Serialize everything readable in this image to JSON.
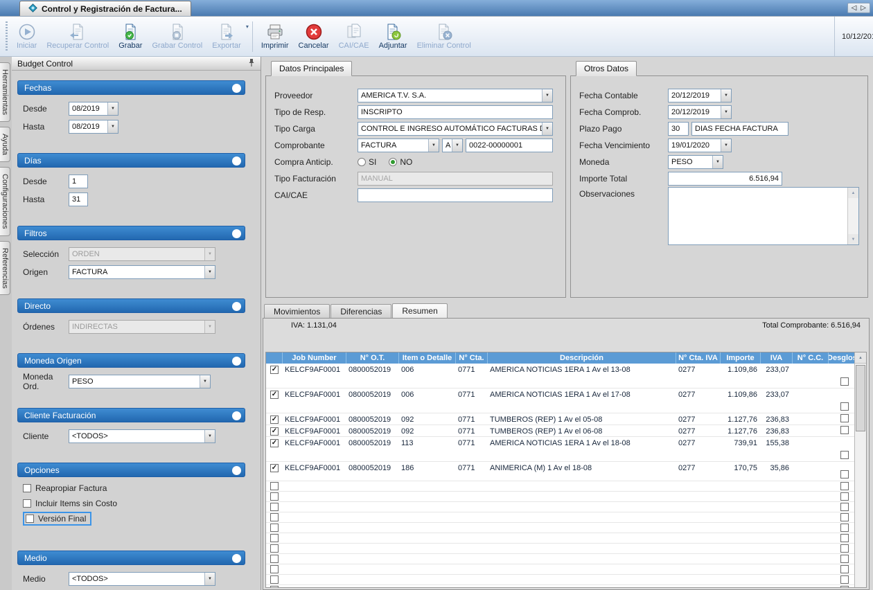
{
  "window": {
    "tab_title": "Control y Registración de Factura...",
    "nav_left_glyph": "◁",
    "nav_right_glyph": "▷"
  },
  "toolbar": {
    "date": "10/12/201",
    "buttons": [
      {
        "label": "Iniciar",
        "enabled": false
      },
      {
        "label": "Recuperar Control",
        "enabled": false
      },
      {
        "label": "Grabar",
        "enabled": true
      },
      {
        "label": "Grabar Control",
        "enabled": false
      },
      {
        "label": "Exportar",
        "enabled": false
      },
      {
        "label": "Imprimir",
        "enabled": true
      },
      {
        "label": "Cancelar",
        "enabled": true
      },
      {
        "label": "CAI/CAE",
        "enabled": false
      },
      {
        "label": "Adjuntar",
        "enabled": true
      },
      {
        "label": "Eliminar Control",
        "enabled": false
      }
    ]
  },
  "side_tabs": [
    {
      "label": "Herramientas"
    },
    {
      "label": "Ayuda"
    },
    {
      "label": "Configuraciones"
    },
    {
      "label": "Referencias"
    }
  ],
  "sidebar": {
    "title": "Budget Control",
    "fechas": {
      "title": "Fechas",
      "desde_label": "Desde",
      "desde_value": "08/2019",
      "hasta_label": "Hasta",
      "hasta_value": "08/2019"
    },
    "dias": {
      "title": "Días",
      "desde_label": "Desde",
      "desde_value": "1",
      "hasta_label": "Hasta",
      "hasta_value": "31"
    },
    "filtros": {
      "title": "Filtros",
      "seleccion_label": "Selección",
      "seleccion_value": "ORDEN",
      "origen_label": "Origen",
      "origen_value": "FACTURA"
    },
    "directo": {
      "title": "Directo",
      "ordenes_label": "Órdenes",
      "ordenes_value": "INDIRECTAS"
    },
    "moneda_origen": {
      "title": "Moneda Origen",
      "label": "Moneda Ord.",
      "value": "PESO"
    },
    "cliente_facturacion": {
      "title": "Cliente Facturación",
      "label": "Cliente",
      "value": "<TODOS>"
    },
    "opciones": {
      "title": "Opciones",
      "items": [
        {
          "label": "Reapropiar Factura",
          "checked": false
        },
        {
          "label": "Incluir Items sin Costo",
          "checked": false
        },
        {
          "label": "Versión Final",
          "checked": false,
          "focused": true
        }
      ]
    },
    "medio": {
      "title": "Medio",
      "label": "Medio",
      "value": "<TODOS>"
    }
  },
  "datos_principales": {
    "tab_label": "Datos Principales",
    "fields": {
      "proveedor_label": "Proveedor",
      "proveedor_value": "AMERICA T.V. S.A.",
      "tipo_resp_label": "Tipo de Resp.",
      "tipo_resp_value": "INSCRIPTO",
      "tipo_carga_label": "Tipo Carga",
      "tipo_carga_value": "CONTROL E INGRESO AUTOMÁTICO FACTURAS DE MED",
      "comprobante_label": "Comprobante",
      "comprobante_tipo": "FACTURA",
      "comprobante_letra": "A",
      "comprobante_numero": "0022-00000001",
      "compra_anticip_label": "Compra Anticip.",
      "si_label": "SI",
      "no_label": "NO",
      "no_selected": true,
      "tipo_facturacion_label": "Tipo Facturación",
      "tipo_facturacion_value": "MANUAL",
      "cai_cae_label": "CAI/CAE",
      "cai_cae_value": ""
    }
  },
  "otros_datos": {
    "tab_label": "Otros Datos",
    "fields": {
      "fecha_contable_label": "Fecha Contable",
      "fecha_contable_value": "20/12/2019",
      "fecha_comprob_label": "Fecha Comprob.",
      "fecha_comprob_value": "20/12/2019",
      "plazo_pago_label": "Plazo Pago",
      "plazo_pago_value": "30",
      "plazo_pago_desc": "DIAS FECHA FACTURA",
      "fecha_vencimiento_label": "Fecha Vencimiento",
      "fecha_vencimiento_value": "19/01/2020",
      "moneda_label": "Moneda",
      "moneda_value": "PESO",
      "importe_total_label": "Importe Total",
      "importe_total_value": "6.516,94",
      "observaciones_label": "Observaciones",
      "observaciones_value": ""
    }
  },
  "detalle": {
    "tabs": [
      {
        "label": "Movimientos",
        "active": false
      },
      {
        "label": "Diferencias",
        "active": false
      },
      {
        "label": "Resumen",
        "active": true
      }
    ],
    "iva_text": "IVA: 1.131,04",
    "total_text": "Total Comprobante: 6.516,94",
    "table": {
      "columns": [
        "",
        "Job Number",
        "N° O.T.",
        "Item o Detalle",
        "N° Cta.",
        "Descripción",
        "N° Cta. IVA",
        "Importe",
        "IVA",
        "N° C.C.",
        "Desglose"
      ],
      "rows": [
        {
          "checked": true,
          "job": "KELCF9AF0001",
          "ot": "0800052019",
          "item": "006",
          "cta": "0771",
          "desc": "AMERICA NOTICIAS 1ERA 1 Av  el 13-08",
          "cta_iva": "0277",
          "importe": "1.109,86",
          "iva": "233,07",
          "cc": "",
          "size": "tall"
        },
        {
          "checked": true,
          "job": "KELCF9AF0001",
          "ot": "0800052019",
          "item": "006",
          "cta": "0771",
          "desc": "AMERICA NOTICIAS 1ERA 1 Av  el 17-08",
          "cta_iva": "0277",
          "importe": "1.109,86",
          "iva": "233,07",
          "cc": "",
          "size": "tall"
        },
        {
          "checked": true,
          "job": "KELCF9AF0001",
          "ot": "0800052019",
          "item": "092",
          "cta": "0771",
          "desc": "TUMBEROS (REP) 1 Av  el 05-08",
          "cta_iva": "0277",
          "importe": "1.127,76",
          "iva": "236,83",
          "cc": "",
          "size": "short"
        },
        {
          "checked": true,
          "job": "KELCF9AF0001",
          "ot": "0800052019",
          "item": "092",
          "cta": "0771",
          "desc": "TUMBEROS (REP) 1 Av  el 06-08",
          "cta_iva": "0277",
          "importe": "1.127,76",
          "iva": "236,83",
          "cc": "",
          "size": "short"
        },
        {
          "checked": true,
          "job": "KELCF9AF0001",
          "ot": "0800052019",
          "item": "113",
          "cta": "0771",
          "desc": "AMERICA NOTICIAS 1ERA 1 Av  el 18-08",
          "cta_iva": "0277",
          "importe": "739,91",
          "iva": "155,38",
          "cc": "",
          "size": "tall"
        },
        {
          "checked": true,
          "job": "KELCF9AF0001",
          "ot": "0800052019",
          "item": "186",
          "cta": "0771",
          "desc": "ANIMERICA (M) 1 Av  el 18-08",
          "cta_iva": "0277",
          "importe": "170,75",
          "iva": "35,86",
          "cc": "",
          "size": "mid"
        }
      ],
      "empty_rows": 11
    }
  },
  "colors": {
    "accent_blue": "#2b74c4",
    "table_header_blue": "#5b9bd5",
    "cancel_red": "#e23b3b",
    "save_green": "#45b649",
    "focus_blue": "#3b94e8"
  }
}
